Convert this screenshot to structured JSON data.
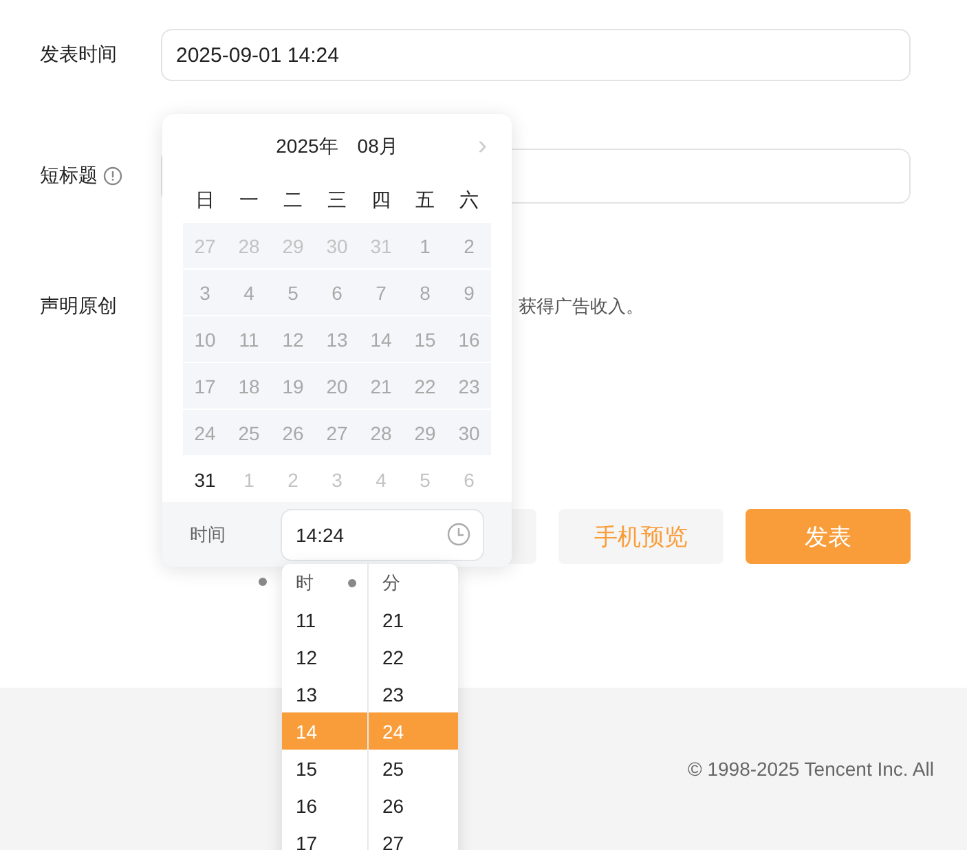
{
  "form": {
    "publish_time": {
      "label": "发表时间",
      "value": "2025-09-01 14:24"
    },
    "short_title": {
      "label": "短标题"
    },
    "original": {
      "label": "声明原创",
      "note": "获得广告收入。"
    }
  },
  "buttons": [
    {
      "kind": "hidden"
    },
    {
      "kind": "secondary",
      "label": "手机预览"
    },
    {
      "kind": "primary",
      "label": "发表"
    }
  ],
  "calendar": {
    "year": "2025年",
    "month": "08月",
    "next": "›",
    "weekdays": [
      "日",
      "一",
      "二",
      "三",
      "四",
      "五",
      "六"
    ],
    "days": [
      {
        "label": "27",
        "disabled": true,
        "other_month": true
      },
      {
        "label": "28",
        "disabled": true,
        "other_month": true
      },
      {
        "label": "29",
        "disabled": true,
        "other_month": true
      },
      {
        "label": "30",
        "disabled": true,
        "other_month": true
      },
      {
        "label": "31",
        "disabled": true,
        "other_month": true
      },
      {
        "label": "1",
        "disabled": true,
        "other_month": false
      },
      {
        "label": "2",
        "disabled": true,
        "other_month": false
      },
      {
        "label": "3",
        "disabled": true,
        "other_month": false
      },
      {
        "label": "4",
        "disabled": true,
        "other_month": false
      },
      {
        "label": "5",
        "disabled": true,
        "other_month": false
      },
      {
        "label": "6",
        "disabled": true,
        "other_month": false
      },
      {
        "label": "7",
        "disabled": true,
        "other_month": false
      },
      {
        "label": "8",
        "disabled": true,
        "other_month": false
      },
      {
        "label": "9",
        "disabled": true,
        "other_month": false
      },
      {
        "label": "10",
        "disabled": true,
        "other_month": false
      },
      {
        "label": "11",
        "disabled": true,
        "other_month": false
      },
      {
        "label": "12",
        "disabled": true,
        "other_month": false
      },
      {
        "label": "13",
        "disabled": true,
        "other_month": false
      },
      {
        "label": "14",
        "disabled": true,
        "other_month": false
      },
      {
        "label": "15",
        "disabled": true,
        "other_month": false
      },
      {
        "label": "16",
        "disabled": true,
        "other_month": false
      },
      {
        "label": "17",
        "disabled": true,
        "other_month": false
      },
      {
        "label": "18",
        "disabled": true,
        "other_month": false
      },
      {
        "label": "19",
        "disabled": true,
        "other_month": false
      },
      {
        "label": "20",
        "disabled": true,
        "other_month": false
      },
      {
        "label": "21",
        "disabled": true,
        "other_month": false
      },
      {
        "label": "22",
        "disabled": true,
        "other_month": false
      },
      {
        "label": "23",
        "disabled": true,
        "other_month": false
      },
      {
        "label": "24",
        "disabled": true,
        "other_month": false
      },
      {
        "label": "25",
        "disabled": true,
        "other_month": false
      },
      {
        "label": "26",
        "disabled": true,
        "other_month": false
      },
      {
        "label": "27",
        "disabled": true,
        "other_month": false
      },
      {
        "label": "28",
        "disabled": true,
        "other_month": false
      },
      {
        "label": "29",
        "disabled": true,
        "other_month": false
      },
      {
        "label": "30",
        "disabled": true,
        "other_month": false
      },
      {
        "label": "31",
        "disabled": false,
        "other_month": false
      },
      {
        "label": "1",
        "disabled": false,
        "other_month": true
      },
      {
        "label": "2",
        "disabled": false,
        "other_month": true
      },
      {
        "label": "3",
        "disabled": false,
        "other_month": true
      },
      {
        "label": "4",
        "disabled": false,
        "other_month": true
      },
      {
        "label": "5",
        "disabled": false,
        "other_month": true
      },
      {
        "label": "6",
        "disabled": false,
        "other_month": true
      }
    ],
    "time_label": "时间",
    "time_value": "14:24"
  },
  "time_picker": {
    "hour_header": "时",
    "minute_header": "分",
    "hours": [
      {
        "label": "11",
        "selected": false
      },
      {
        "label": "12",
        "selected": false
      },
      {
        "label": "13",
        "selected": false
      },
      {
        "label": "14",
        "selected": true
      },
      {
        "label": "15",
        "selected": false
      },
      {
        "label": "16",
        "selected": false
      },
      {
        "label": "17",
        "selected": false
      }
    ],
    "minutes": [
      {
        "label": "21",
        "selected": false
      },
      {
        "label": "22",
        "selected": false
      },
      {
        "label": "23",
        "selected": false
      },
      {
        "label": "24",
        "selected": true
      },
      {
        "label": "25",
        "selected": false
      },
      {
        "label": "26",
        "selected": false
      },
      {
        "label": "27",
        "selected": false
      }
    ]
  },
  "footer": {
    "copyright": "© 1998-2025 Tencent Inc. All"
  }
}
